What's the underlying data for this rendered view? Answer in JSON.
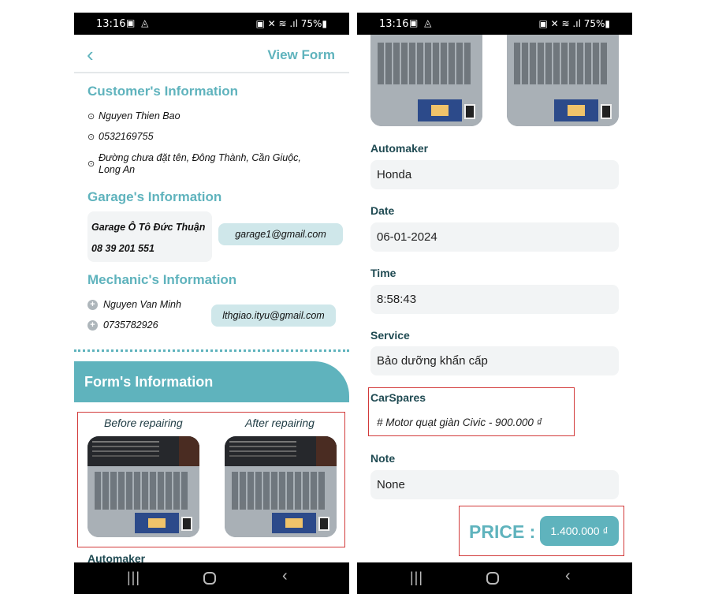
{
  "status_bar": {
    "time": "13:16",
    "left_icons": "▣ ◬",
    "right": "▣ ✕ ≋ .ıl 75%▮"
  },
  "header": {
    "view_form": "View Form"
  },
  "customer": {
    "title": "Customer's Information",
    "name": "Nguyen Thien Bao",
    "phone": "0532169755",
    "address": "Đường chưa đặt tên, Đông Thành, Cần Giuộc, Long An"
  },
  "garage": {
    "title": "Garage's Information",
    "name": "Garage Ô Tô Đức Thuận",
    "phone": "08 39 201 551",
    "email": "garage1@gmail.com"
  },
  "mechanic": {
    "title": "Mechanic's Information",
    "name": "Nguyen Van Minh",
    "phone": "0735782926",
    "email": "lthgiao.ityu@gmail.com"
  },
  "form": {
    "title": "Form's Information",
    "before_label": "Before repairing",
    "after_label": "After repairing",
    "automaker_label": "Automaker",
    "automaker": "Honda",
    "date_label": "Date",
    "date": "06-01-2024",
    "time_label": "Time",
    "time": "8:58:43",
    "service_label": "Service",
    "service": "Bảo dưỡng khẩn cấp",
    "carspares_label": "CarSpares",
    "carspares": "# Motor quạt giàn Civic - 900.000 ₫",
    "note_label": "Note",
    "note": "None",
    "price_label": "PRICE :",
    "price": "1.400.000 ₫"
  },
  "icons": {
    "back": "chevron-left-icon",
    "radio": "radio-dot-icon",
    "plus": "plus-circle-icon",
    "nav_recent": "recent-apps-icon",
    "nav_home": "home-icon",
    "nav_back": "nav-back-icon"
  },
  "colors": {
    "accent": "#5fb3bd",
    "pill": "#cfe7ea",
    "field_bg": "#f2f4f5",
    "highlight_border": "#d23a3a"
  }
}
